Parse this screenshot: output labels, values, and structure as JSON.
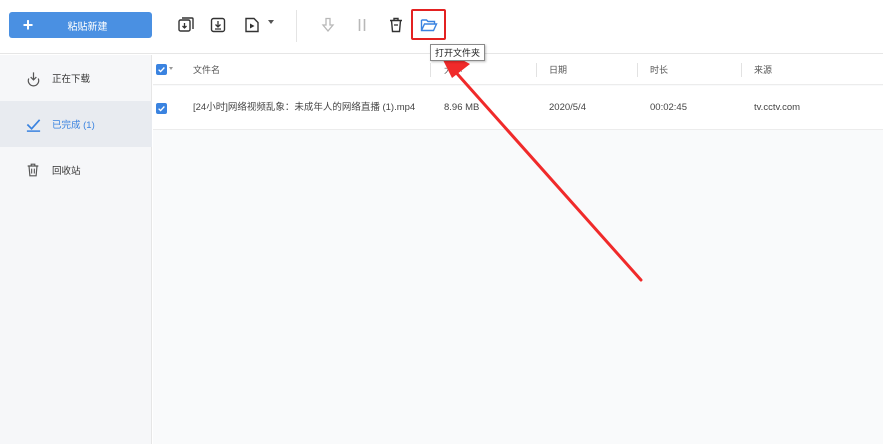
{
  "toolbar": {
    "paste_label": "粘贴新建",
    "tooltip": "打开文件夹",
    "colors": {
      "accent": "#4a90e2",
      "highlight": "#e32121"
    },
    "icons": [
      "new-task-icon",
      "import-icon",
      "video-dropdown-icon",
      "download-icon",
      "pause-icon",
      "delete-icon",
      "folder-open-icon"
    ]
  },
  "sidebar": {
    "items": [
      {
        "label": "正在下载",
        "icon": "download-icon",
        "active": false
      },
      {
        "label": "已完成 (1)",
        "icon": "check-icon",
        "active": true
      },
      {
        "label": "回收站",
        "icon": "trash-icon",
        "active": false
      }
    ]
  },
  "table": {
    "columns": [
      "文件名",
      "大小",
      "日期",
      "时长",
      "来源"
    ],
    "rows": [
      {
        "checked": true,
        "filename": "[24小时]网络视频乱象：未成年人的网络直播 (1).mp4",
        "size": "8.96 MB",
        "date": "2020/5/4",
        "duration": "00:02:45",
        "source": "tv.cctv.com"
      }
    ]
  }
}
